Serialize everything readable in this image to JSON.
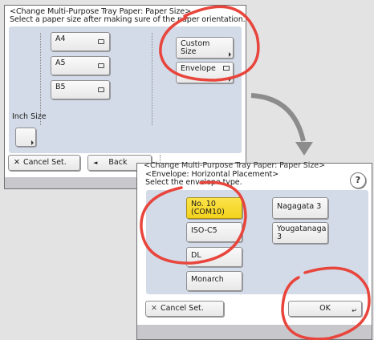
{
  "screen1": {
    "title_line1": "<Change Multi-Purpose Tray Paper: Paper Size>",
    "title_line2": "Select a paper size after making sure of the paper orientation.",
    "size_buttons": [
      "A4",
      "A5",
      "B5"
    ],
    "custom_size": [
      "Custom",
      "Size"
    ],
    "envelope_label": "Envelope",
    "inch_size_label": "Inch Size",
    "cancel_label": "Cancel Set.",
    "back_label": "Back"
  },
  "screen2": {
    "title_peek": "<Change Multi-Purpose Tray Paper: Paper Size>",
    "title_line1": "<Envelope: Horizontal Placement>",
    "title_line2": "Select the envelope type.",
    "help_label": "?",
    "envelopes": {
      "no10": [
        "No. 10",
        "(COM10)"
      ],
      "nagagata": "Nagagata 3",
      "isoc5": "ISO-C5",
      "yougatanaga": [
        "Yougatanaga",
        "3"
      ],
      "dl": "DL",
      "monarch": "Monarch"
    },
    "cancel_label": "Cancel Set.",
    "ok_label": "OK"
  },
  "colors": {
    "annotation_red": "#e8453c",
    "arrow_gray": "#8c8c8c",
    "selected_yellow": "#f6d928",
    "panel_inner": "#d3dbe8"
  },
  "icons": [
    "portrait-paper-icon",
    "envelope-icon",
    "close-x-icon",
    "back-triangle-icon",
    "help-icon",
    "enter-icon",
    "curved-arrow"
  ]
}
